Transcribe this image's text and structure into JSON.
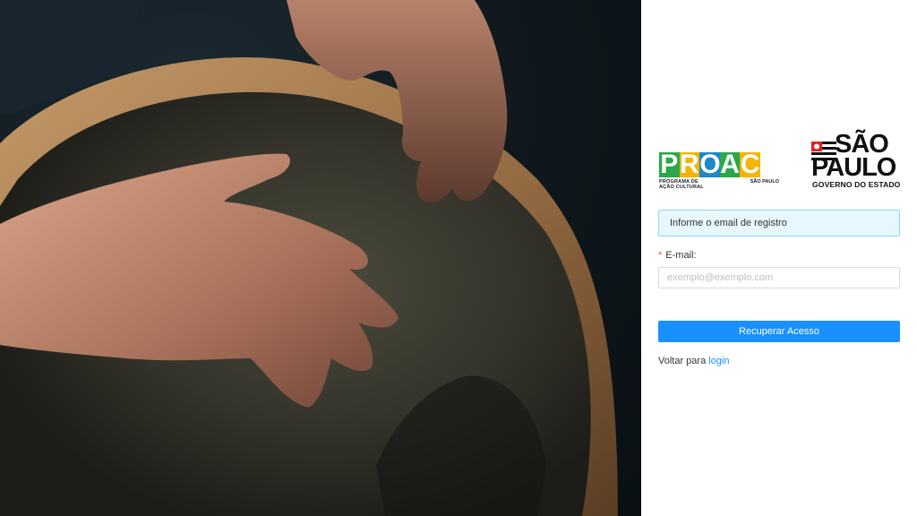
{
  "hero": {
    "alt": "Mãos tocando tambor"
  },
  "logos": {
    "proac": {
      "letters": [
        "P",
        "R",
        "O",
        "A",
        "C"
      ],
      "letter_colors": [
        "#2aa84a",
        "#f5b400",
        "#1e88c8",
        "#2aa84a",
        "#f5b400"
      ],
      "subtitle_line1": "PROGRAMA DE",
      "subtitle_line2": "AÇÃO CULTURAL",
      "region": "SÃO PAULO"
    },
    "sao_paulo": {
      "line1": "SÃO",
      "line2": "PAULO",
      "tagline": "GOVERNO DO ESTADO"
    }
  },
  "form": {
    "info_message": "Informe o email de registro",
    "email_label": "E-mail:",
    "required_mark": "*",
    "email_placeholder": "exemplo@exemplo.com",
    "email_value": "",
    "submit_label": "Recuperar Acesso",
    "back_text": "Voltar para",
    "back_link": "login"
  },
  "colors": {
    "primary": "#1890ff",
    "info_bg": "#e6f7ff",
    "info_border": "#91d5ff",
    "required": "#ff4d4f"
  }
}
